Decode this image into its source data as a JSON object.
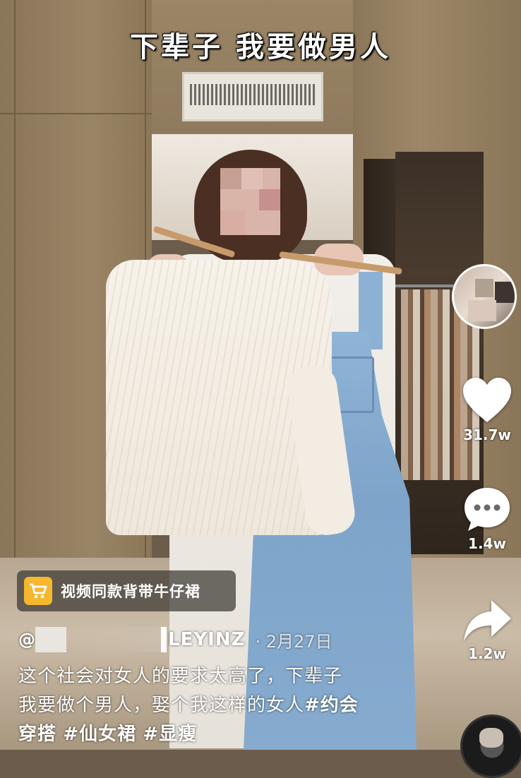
{
  "video": {
    "caption": "下辈子 我要做男人"
  },
  "actions": {
    "like_count": "31.7w",
    "comment_count": "1.4w",
    "share_count": "1.2w"
  },
  "product": {
    "label": "视频同款背带牛仔裙"
  },
  "author": {
    "at_symbol": "@",
    "name_visible": "LEYINZ",
    "separator": "·",
    "date": "2月27日"
  },
  "description": {
    "line1": "这个社会对女人的要求太高了，下辈子",
    "line2_text": "我要做个男人，娶个我这样的女人",
    "line2_tag": "#约会",
    "line3_tag_cont": "穿搭",
    "line3_tag2": "#仙女裙",
    "line3_tag3": "#显瘦"
  },
  "colors": {
    "cart_badge": "#f5b82e",
    "overlay_text": "#ffffff"
  },
  "icons": {
    "like": "heart-icon",
    "comment": "comment-bubble-icon",
    "share": "share-arrow-icon",
    "cart": "shopping-cart-icon",
    "music": "music-disc-icon"
  }
}
